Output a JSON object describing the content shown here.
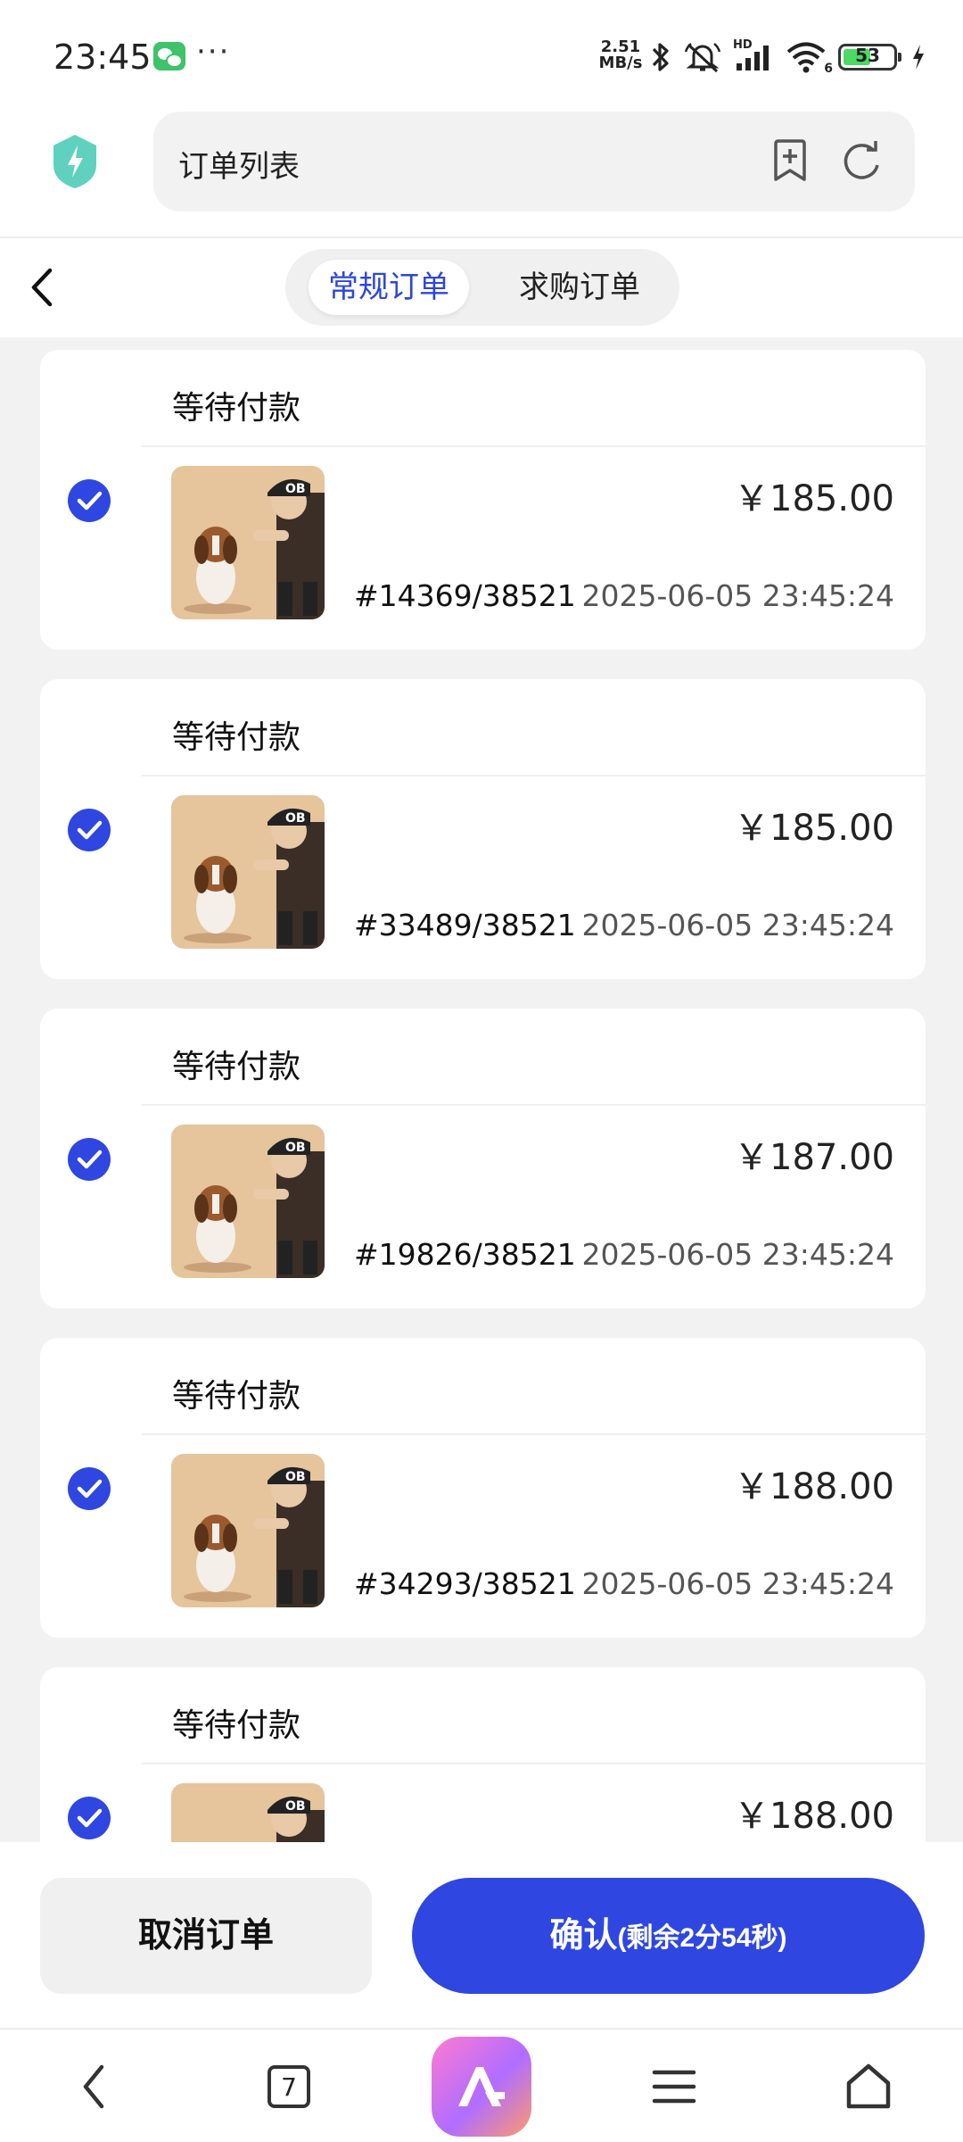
{
  "status_bar": {
    "time": "23:45",
    "net_speed_value": "2.51",
    "net_speed_unit": "MB/s",
    "network_badge": "HD",
    "wifi_badge": "6",
    "battery_level": "53"
  },
  "browser": {
    "address_text": "订单列表"
  },
  "tabs": [
    {
      "label": "常规订单",
      "active": true
    },
    {
      "label": "求购订单",
      "active": false
    }
  ],
  "orders": [
    {
      "status": "等待付款",
      "price": "￥185.00",
      "order_no": "#14369/38521",
      "time": "2025-06-05 23:45:24",
      "checked": true
    },
    {
      "status": "等待付款",
      "price": "￥185.00",
      "order_no": "#33489/38521",
      "time": "2025-06-05 23:45:24",
      "checked": true
    },
    {
      "status": "等待付款",
      "price": "￥187.00",
      "order_no": "#19826/38521",
      "time": "2025-06-05 23:45:24",
      "checked": true
    },
    {
      "status": "等待付款",
      "price": "￥188.00",
      "order_no": "#34293/38521",
      "time": "2025-06-05 23:45:24",
      "checked": true
    },
    {
      "status": "等待付款",
      "price": "￥188.00",
      "order_no": "",
      "time": "",
      "checked": true
    }
  ],
  "actions": {
    "cancel_label": "取消订单",
    "confirm_label": "确认",
    "confirm_countdown": "(剩余2分54秒)"
  },
  "nav": {
    "tab_count": "7"
  },
  "colors": {
    "accent": "#2f47e0",
    "tab_active_text": "#2c46d9",
    "check": "#2f47e0"
  },
  "icons": [
    "wechat-icon",
    "more-dots-icon",
    "bluetooth-icon",
    "alarm-off-icon",
    "signal-icon",
    "wifi-icon",
    "battery-icon",
    "charging-icon",
    "shield-icon",
    "bookmark-add-icon",
    "refresh-icon",
    "back-icon",
    "check-circle-icon",
    "menu-icon",
    "home-icon"
  ]
}
